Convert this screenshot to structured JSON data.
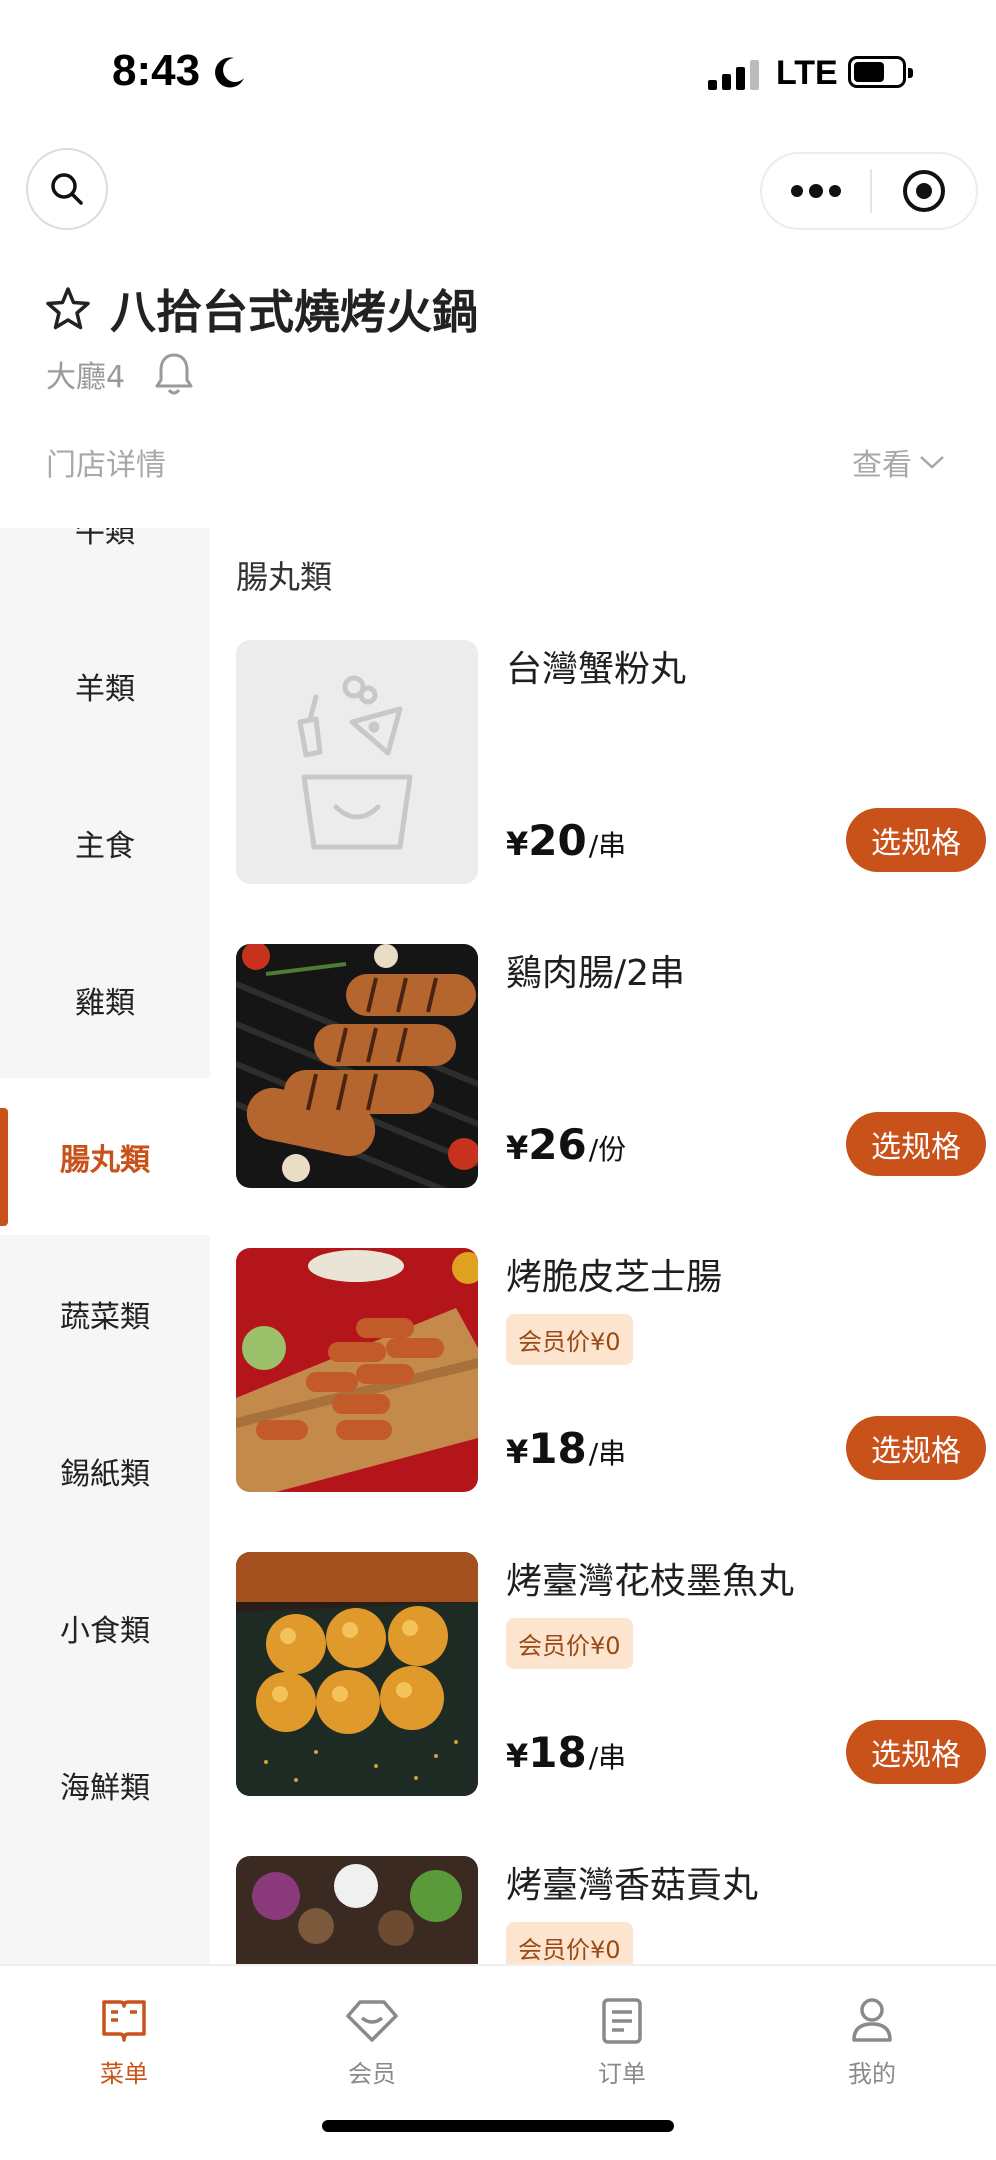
{
  "status_bar": {
    "time": "8:43",
    "network": "LTE"
  },
  "store": {
    "name": "八拾台式燒烤火鍋",
    "hall": "大廳4",
    "detail_label": "门店详情",
    "view_label": "查看"
  },
  "sidebar": {
    "categories": [
      {
        "label": "牛類",
        "active": false
      },
      {
        "label": "羊類",
        "active": false
      },
      {
        "label": "主食",
        "active": false
      },
      {
        "label": "雞類",
        "active": false
      },
      {
        "label": "腸丸類",
        "active": true
      },
      {
        "label": "蔬菜類",
        "active": false
      },
      {
        "label": "錫紙類",
        "active": false
      },
      {
        "label": "小食類",
        "active": false
      },
      {
        "label": "海鮮類",
        "active": false
      }
    ]
  },
  "section": {
    "title": "腸丸類"
  },
  "products": [
    {
      "name": "台灣蟹粉丸",
      "member_tag": "",
      "currency": "¥",
      "price": "20",
      "unit": "/串",
      "button": "选规格",
      "image": "placeholder-icon"
    },
    {
      "name": "鷄肉腸/2串",
      "member_tag": "",
      "currency": "¥",
      "price": "26",
      "unit": "/份",
      "button": "选规格",
      "image": "grilled-sausage-photo"
    },
    {
      "name": "烤脆皮芝士腸",
      "member_tag": "会员价¥0",
      "currency": "¥",
      "price": "18",
      "unit": "/串",
      "button": "选规格",
      "image": "cheese-sausage-photo"
    },
    {
      "name": "烤臺灣花枝墨魚丸",
      "member_tag": "会员价¥0",
      "currency": "¥",
      "price": "18",
      "unit": "/串",
      "button": "选规格",
      "image": "cuttlefish-ball-photo"
    },
    {
      "name": "烤臺灣香菇貢丸",
      "member_tag": "会员价¥0",
      "currency": "",
      "price": "",
      "unit": "",
      "button": "",
      "image": "mushroom-meatball-photo"
    }
  ],
  "tabbar": {
    "tabs": [
      {
        "label": "菜单",
        "icon": "menu-book-icon",
        "active": true
      },
      {
        "label": "会员",
        "icon": "member-diamond-icon",
        "active": false
      },
      {
        "label": "订单",
        "icon": "order-list-icon",
        "active": false
      },
      {
        "label": "我的",
        "icon": "profile-icon",
        "active": false
      }
    ]
  },
  "colors": {
    "accent": "#c9521a",
    "member_tag_bg": "#fde4cf",
    "sidebar_bg": "#f6f6f6"
  }
}
